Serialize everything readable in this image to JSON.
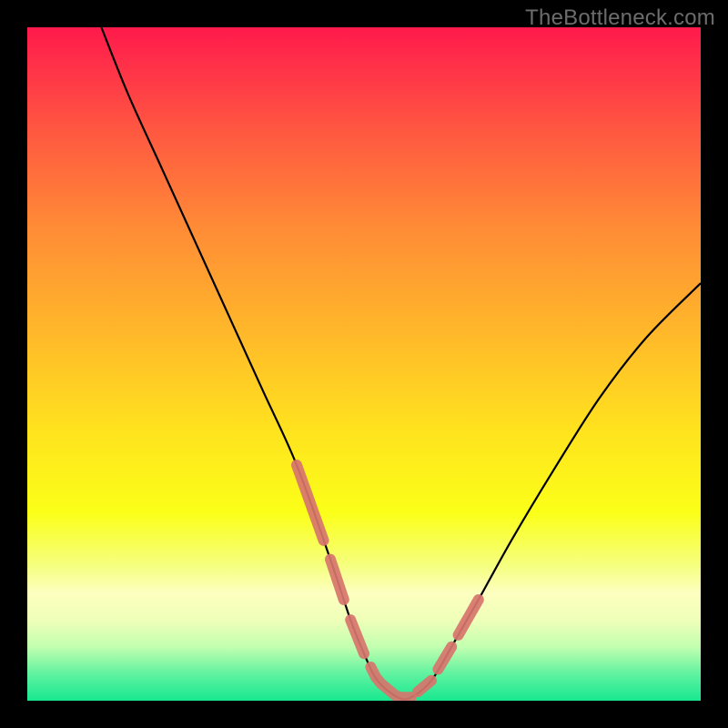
{
  "watermark": "TheBottleneck.com",
  "chart_data": {
    "type": "line",
    "title": "",
    "xlabel": "",
    "ylabel": "",
    "xlim": [
      0,
      100
    ],
    "ylim": [
      0,
      100
    ],
    "grid": false,
    "legend": false,
    "series": [
      {
        "name": "curve",
        "color": "#000000",
        "x": [
          11,
          15,
          20,
          25,
          30,
          35,
          40,
          45,
          48,
          50,
          52,
          55,
          57,
          60,
          63,
          67,
          72,
          78,
          85,
          92,
          100
        ],
        "y": [
          100,
          90,
          79,
          68,
          57,
          46,
          35,
          21,
          12,
          7,
          3,
          0.5,
          0.5,
          3,
          8,
          15,
          24,
          34,
          45,
          54,
          62
        ]
      }
    ],
    "highlight_segments": {
      "comment": "thicker salmon segments overlaid on the black curve near the trough",
      "color": "#d7756d",
      "ranges_x": [
        [
          40,
          44
        ],
        [
          45,
          47
        ],
        [
          48,
          50
        ],
        [
          51,
          57
        ],
        [
          58,
          60
        ],
        [
          61,
          63
        ],
        [
          64,
          67
        ]
      ]
    },
    "background_gradient": {
      "stops": [
        {
          "pos": 0.0,
          "color": "#ff1a4b"
        },
        {
          "pos": 0.04,
          "color": "#ff2a4a"
        },
        {
          "pos": 0.15,
          "color": "#ff5641"
        },
        {
          "pos": 0.3,
          "color": "#ff8c36"
        },
        {
          "pos": 0.45,
          "color": "#ffb72a"
        },
        {
          "pos": 0.6,
          "color": "#ffe31e"
        },
        {
          "pos": 0.72,
          "color": "#fbff18"
        },
        {
          "pos": 0.8,
          "color": "#f5ff80"
        },
        {
          "pos": 0.84,
          "color": "#fdffc0"
        },
        {
          "pos": 0.88,
          "color": "#efffb8"
        },
        {
          "pos": 0.92,
          "color": "#c2ffb0"
        },
        {
          "pos": 0.96,
          "color": "#60f2a0"
        },
        {
          "pos": 1.0,
          "color": "#18e890"
        }
      ]
    }
  }
}
